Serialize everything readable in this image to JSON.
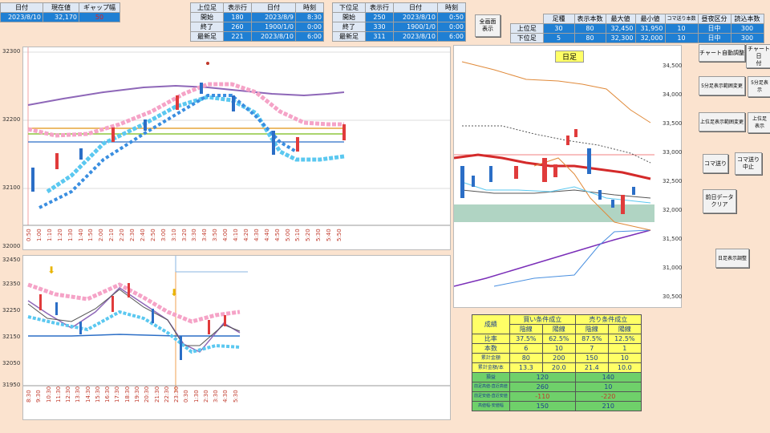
{
  "top_left": {
    "headers": [
      "日付",
      "現在値",
      "ギャップ幅"
    ],
    "values": [
      "2023/8/10",
      "32,170",
      "50"
    ]
  },
  "upper": {
    "headers": [
      "上位足",
      "表示行",
      "日付",
      "時刻"
    ],
    "rows": [
      [
        "開始",
        "180",
        "2023/8/9",
        "8:30"
      ],
      [
        "終了",
        "260",
        "1900/1/0",
        "0:00"
      ],
      [
        "最新足",
        "221",
        "2023/8/10",
        "6:00"
      ]
    ]
  },
  "lower": {
    "headers": [
      "下位足",
      "表示行",
      "日付",
      "時刻"
    ],
    "rows": [
      [
        "開始",
        "250",
        "2023/8/10",
        "0:50"
      ],
      [
        "終了",
        "330",
        "1900/1/0",
        "0:00"
      ],
      [
        "最新足",
        "311",
        "2023/8/10",
        "6:00"
      ]
    ]
  },
  "fullscreen_button": "全画面\n表示",
  "right_table": {
    "headers": [
      "",
      "足種",
      "表示本数",
      "最大値",
      "最小値",
      "コマ送り本数",
      "昼夜区分",
      "読込本数"
    ],
    "rows": [
      [
        "上位足",
        "30",
        "80",
        "32,450",
        "31,950",
        "10",
        "日中",
        "300"
      ],
      [
        "下位足",
        "5",
        "80",
        "32,300",
        "32,000",
        "10",
        "日中",
        "300"
      ]
    ]
  },
  "buttons": {
    "chart_auto": "チャート自動調整",
    "chart_2": "チャート日\n付",
    "five_min_range": "5分足表示範囲変更",
    "five_min_2": "5分足表\n示",
    "upper_range": "上位足表示範囲変更",
    "upper_2": "上位足\n表示",
    "koma_okuri": "コマ送り",
    "koma_stop": "コマ送り\n中止",
    "prev_clear": "前日データ\nクリア",
    "daily_settings": "日足表示調整"
  },
  "daily_chart_title": "日足",
  "upper_chart": {
    "y_ticks": [
      "32300",
      "32200",
      "32100",
      "32000"
    ],
    "x_ticks": [
      "0:50",
      "1:00",
      "1:10",
      "1:20",
      "1:30",
      "1:40",
      "1:50",
      "2:00",
      "2:10",
      "2:20",
      "2:30",
      "2:40",
      "2:50",
      "3:00",
      "3:10",
      "3:20",
      "3:30",
      "3:40",
      "3:50",
      "4:00",
      "4:10",
      "4:20",
      "4:30",
      "4:40",
      "4:50",
      "5:00",
      "5:10",
      "5:20",
      "5:30",
      "5:40",
      "5:50"
    ]
  },
  "lower_chart": {
    "y_ticks": [
      "32450",
      "32350",
      "32250",
      "32150",
      "32050",
      "31950"
    ],
    "x_ticks": [
      "8:30",
      "9:30",
      "10:30",
      "11:30",
      "12:30",
      "13:30",
      "14:30",
      "15:30",
      "16:30",
      "17:30",
      "18:30",
      "19:30",
      "20:30",
      "21:30",
      "22:30",
      "23:30",
      "0:30",
      "1:30",
      "2:30",
      "3:30",
      "4:30",
      "5:30"
    ]
  },
  "daily_chart": {
    "y_ticks": [
      "34,500",
      "34,000",
      "33,500",
      "33,000",
      "32,500",
      "32,000",
      "31,500",
      "31,000",
      "30,500"
    ]
  },
  "stats": {
    "title": "成績",
    "buy": "買い条件成立",
    "sell": "売り条件成立",
    "sub": [
      "陰線",
      "陽線",
      "陰線",
      "陽線"
    ],
    "rows": [
      {
        "label": "比率",
        "vals": [
          "37.5%",
          "62.5%",
          "87.5%",
          "12.5%"
        ]
      },
      {
        "label": "本数",
        "vals": [
          "6",
          "10",
          "7",
          "1"
        ]
      },
      {
        "label": "累計金額",
        "vals": [
          "80",
          "200",
          "150",
          "10"
        ]
      },
      {
        "label": "累計金額/本",
        "vals": [
          "13.3",
          "20.0",
          "21.4",
          "10.0"
        ]
      }
    ],
    "rows2": [
      {
        "label": "損益",
        "buy": "120",
        "sell": "140"
      },
      {
        "label": "前足高値-直近高値",
        "buy": "260",
        "sell": "10"
      },
      {
        "label": "前足安値-直近安値",
        "buy": "-110",
        "sell": "-220"
      },
      {
        "label": "高値幅-安値幅",
        "buy": "150",
        "sell": "210"
      }
    ]
  }
}
